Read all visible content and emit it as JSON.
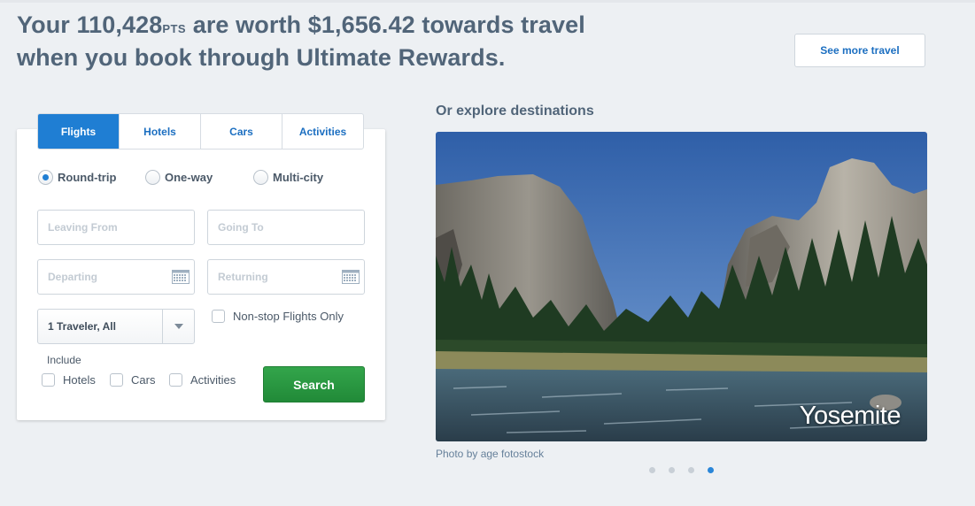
{
  "header": {
    "line1_pre": "Your 110,428",
    "pts_label": "PTS",
    "line1_post": " are worth $1,656.42 towards travel",
    "line2": "when you book through Ultimate Rewards.",
    "see_more_button": "See more travel"
  },
  "booking": {
    "tabs": [
      {
        "label": "Flights",
        "active": true
      },
      {
        "label": "Hotels",
        "active": false
      },
      {
        "label": "Cars",
        "active": false
      },
      {
        "label": "Activities",
        "active": false
      }
    ],
    "trip_types": [
      {
        "label": "Round-trip",
        "checked": true
      },
      {
        "label": "One-way",
        "checked": false
      },
      {
        "label": "Multi-city",
        "checked": false
      }
    ],
    "leaving_from_placeholder": "Leaving From",
    "going_to_placeholder": "Going To",
    "departing_placeholder": "Departing",
    "returning_placeholder": "Returning",
    "travelers_value": "1 Traveler, All",
    "nonstop_label": "Non-stop Flights Only",
    "include_label": "Include",
    "include_options": [
      "Hotels",
      "Cars",
      "Activities"
    ],
    "search_button": "Search"
  },
  "destinations": {
    "title": "Or explore destinations",
    "current_name": "Yosemite",
    "photo_credit": "Photo by age fotostock",
    "slide_count": 4,
    "active_slide": 4
  },
  "colors": {
    "accent_blue": "#1f7ed3",
    "search_green": "#2a9a42",
    "heading": "#516579"
  }
}
